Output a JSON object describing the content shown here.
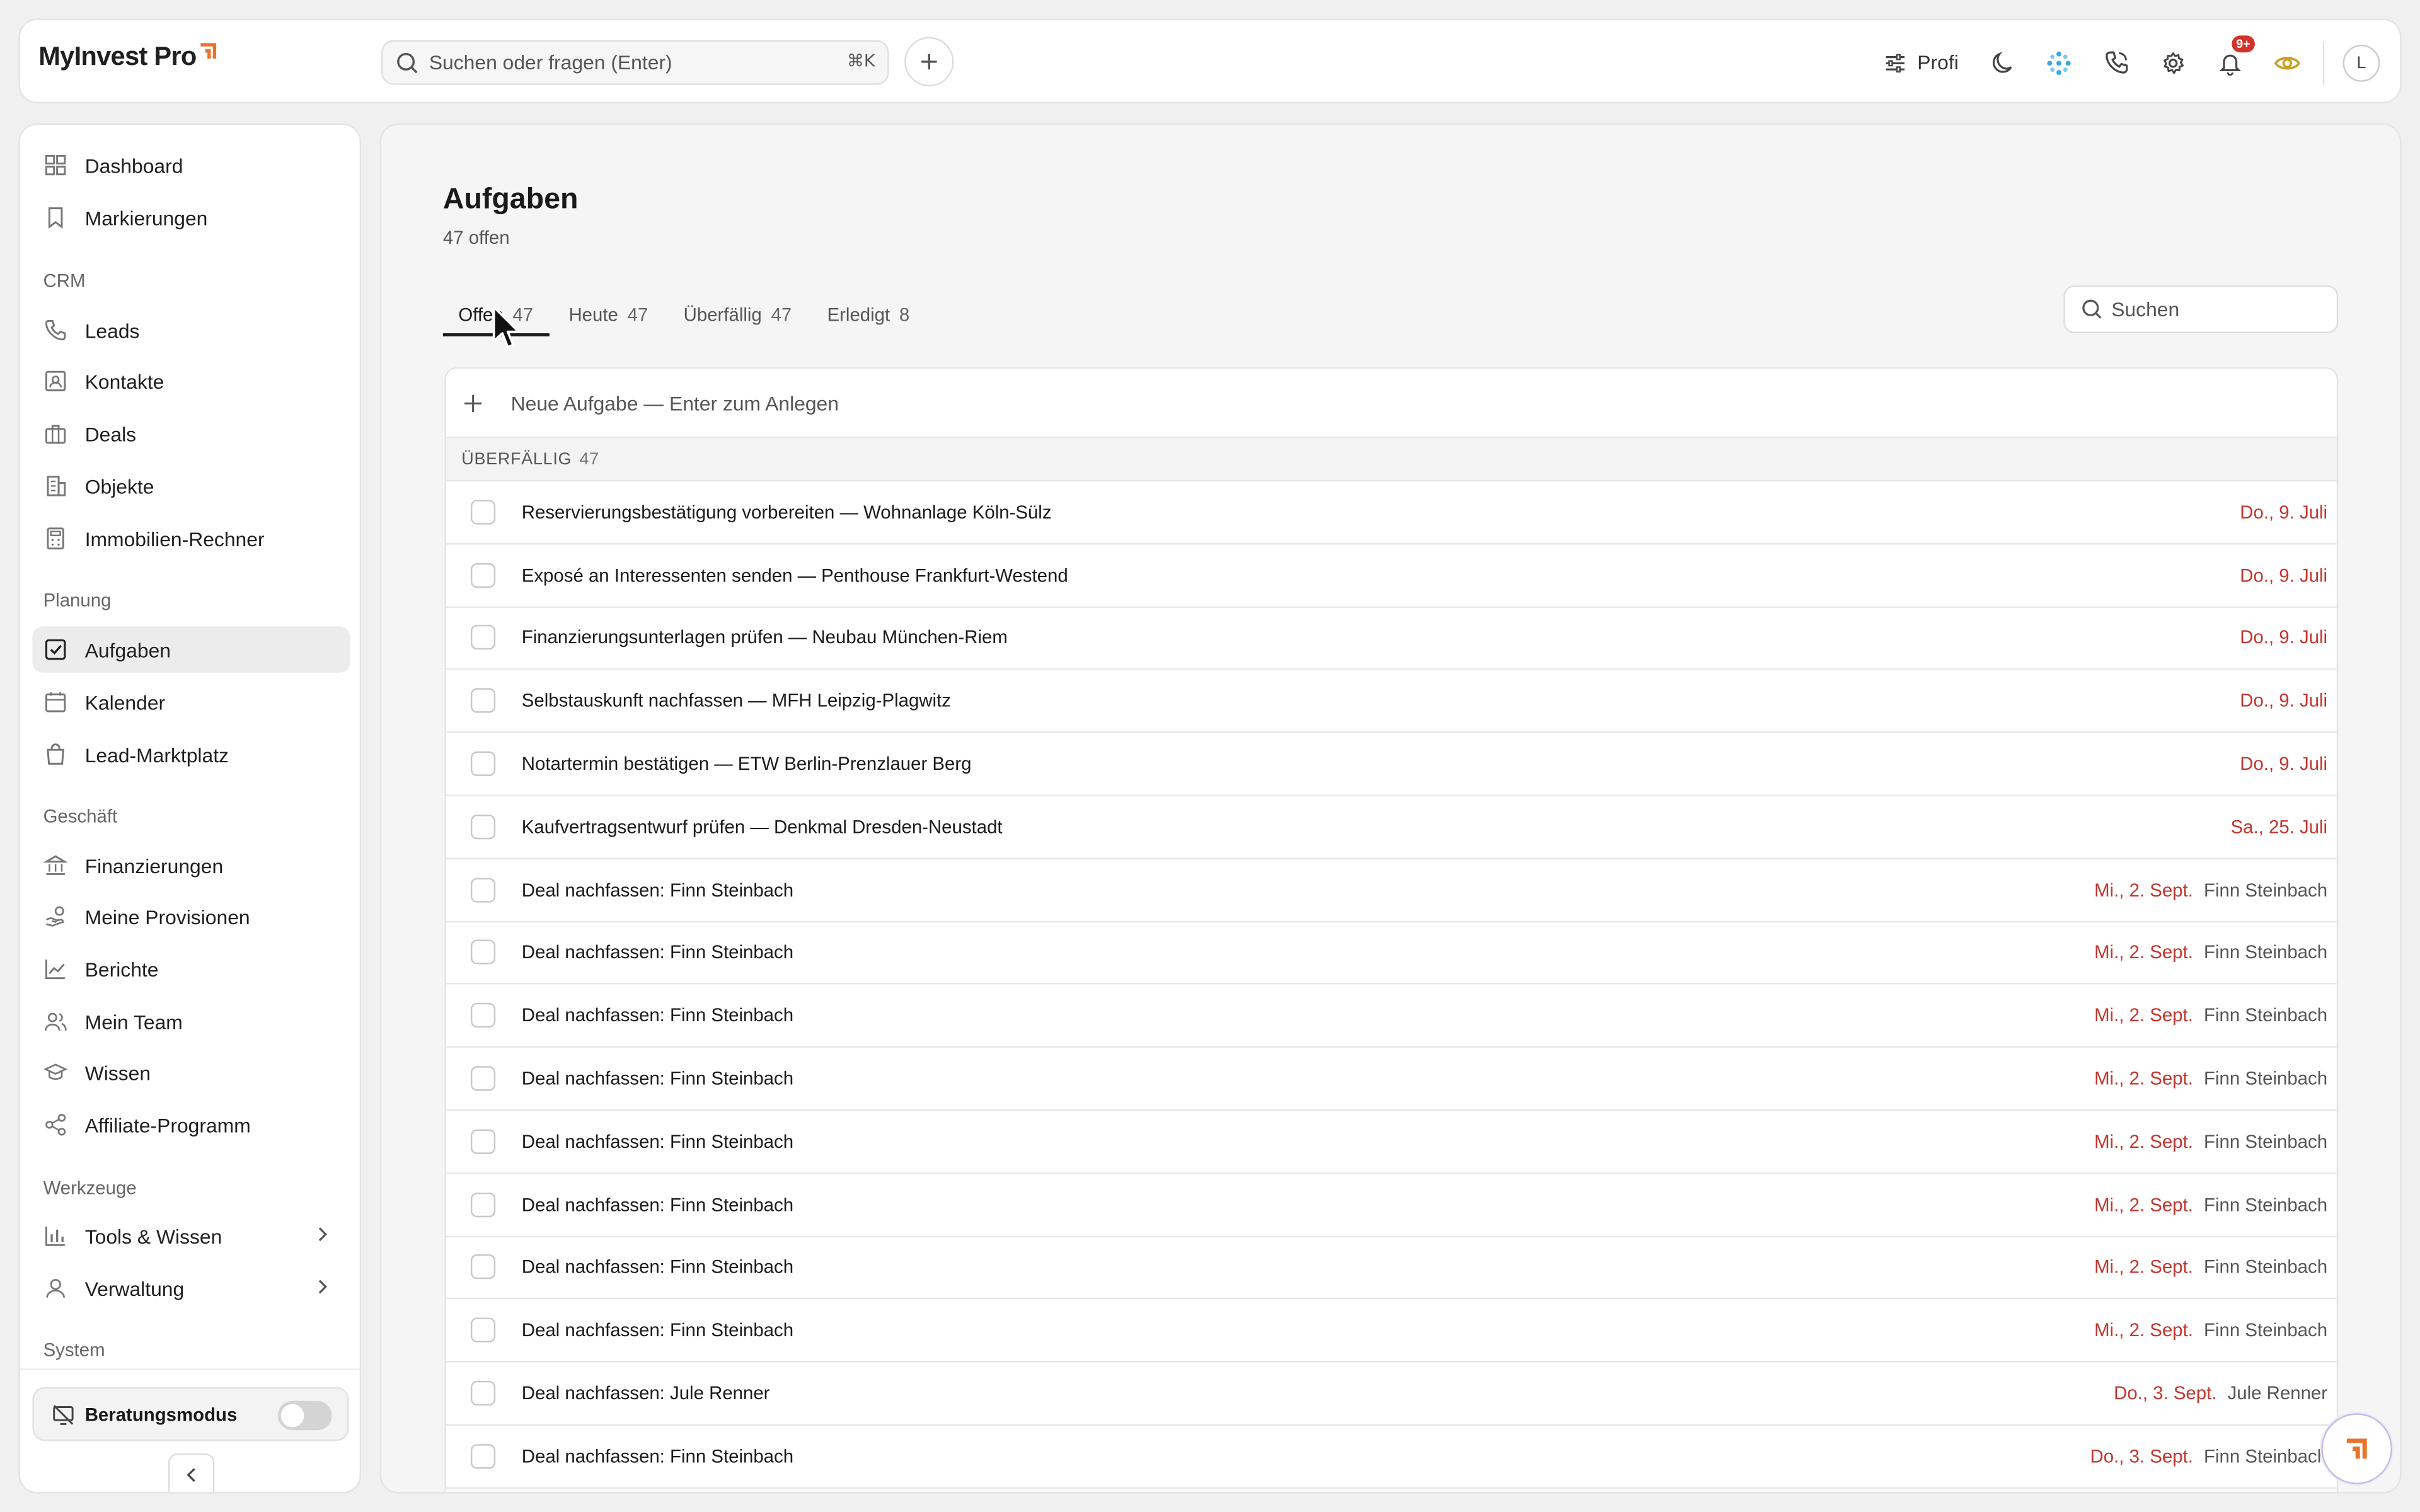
{
  "app": {
    "brand": "MyInvest Pro",
    "accent": "#e8732a"
  },
  "topbar": {
    "search_placeholder": "Suchen oder fragen (Enter)",
    "search_shortcut": "⌘K",
    "profile_mode": "Profi",
    "notifications_badge": "9+",
    "avatar_initial": "L"
  },
  "sidebar": {
    "top_items": [
      {
        "label": "Dashboard"
      },
      {
        "label": "Markierungen"
      }
    ],
    "crm": {
      "title": "CRM",
      "items": [
        {
          "label": "Leads"
        },
        {
          "label": "Kontakte"
        },
        {
          "label": "Deals"
        },
        {
          "label": "Objekte"
        },
        {
          "label": "Immobilien-Rechner"
        }
      ]
    },
    "planung": {
      "title": "Planung",
      "items": [
        {
          "label": "Aufgaben"
        },
        {
          "label": "Kalender"
        },
        {
          "label": "Lead-Marktplatz"
        }
      ]
    },
    "geschaeft": {
      "title": "Geschäft",
      "items": [
        {
          "label": "Finanzierungen"
        },
        {
          "label": "Meine Provisionen"
        },
        {
          "label": "Berichte"
        },
        {
          "label": "Mein Team"
        },
        {
          "label": "Wissen"
        },
        {
          "label": "Affiliate-Programm"
        }
      ]
    },
    "werkzeuge": {
      "title": "Werkzeuge",
      "items": [
        {
          "label": "Tools & Wissen"
        },
        {
          "label": "Verwaltung"
        }
      ]
    },
    "system": {
      "title": "System"
    },
    "beratungsmodus": {
      "label": "Beratungsmodus",
      "enabled": false
    },
    "active_item": "Aufgaben"
  },
  "main": {
    "title": "Aufgaben",
    "subtitle": "47 offen",
    "tabs": [
      {
        "label": "Offen",
        "count": "47"
      },
      {
        "label": "Heute",
        "count": "47"
      },
      {
        "label": "Überfällig",
        "count": "47"
      },
      {
        "label": "Erledigt",
        "count": "8"
      }
    ],
    "active_tab": "Offen",
    "search_placeholder": "Suchen",
    "new_task_placeholder": "Neue Aufgabe — Enter zum Anlegen",
    "group": {
      "label": "ÜBERFÄLLIG",
      "count": "47"
    },
    "tasks": [
      {
        "title": "Reservierungsbestätigung vorbereiten — Wohnanlage Köln-Sülz",
        "date": "Do., 9. Juli",
        "assignee": ""
      },
      {
        "title": "Exposé an Interessenten senden — Penthouse Frankfurt-Westend",
        "date": "Do., 9. Juli",
        "assignee": ""
      },
      {
        "title": "Finanzierungsunterlagen prüfen — Neubau München-Riem",
        "date": "Do., 9. Juli",
        "assignee": ""
      },
      {
        "title": "Selbstauskunft nachfassen — MFH Leipzig-Plagwitz",
        "date": "Do., 9. Juli",
        "assignee": ""
      },
      {
        "title": "Notartermin bestätigen — ETW Berlin-Prenzlauer Berg",
        "date": "Do., 9. Juli",
        "assignee": ""
      },
      {
        "title": "Kaufvertragsentwurf prüfen — Denkmal Dresden-Neustadt",
        "date": "Sa., 25. Juli",
        "assignee": ""
      },
      {
        "title": "Deal nachfassen: Finn Steinbach",
        "date": "Mi., 2. Sept.",
        "assignee": "Finn Steinbach"
      },
      {
        "title": "Deal nachfassen: Finn Steinbach",
        "date": "Mi., 2. Sept.",
        "assignee": "Finn Steinbach"
      },
      {
        "title": "Deal nachfassen: Finn Steinbach",
        "date": "Mi., 2. Sept.",
        "assignee": "Finn Steinbach"
      },
      {
        "title": "Deal nachfassen: Finn Steinbach",
        "date": "Mi., 2. Sept.",
        "assignee": "Finn Steinbach"
      },
      {
        "title": "Deal nachfassen: Finn Steinbach",
        "date": "Mi., 2. Sept.",
        "assignee": "Finn Steinbach"
      },
      {
        "title": "Deal nachfassen: Finn Steinbach",
        "date": "Mi., 2. Sept.",
        "assignee": "Finn Steinbach"
      },
      {
        "title": "Deal nachfassen: Finn Steinbach",
        "date": "Mi., 2. Sept.",
        "assignee": "Finn Steinbach"
      },
      {
        "title": "Deal nachfassen: Finn Steinbach",
        "date": "Mi., 2. Sept.",
        "assignee": "Finn Steinbach"
      },
      {
        "title": "Deal nachfassen: Jule Renner",
        "date": "Do., 3. Sept.",
        "assignee": "Jule Renner"
      },
      {
        "title": "Deal nachfassen: Finn Steinbach",
        "date": "Do., 3. Sept.",
        "assignee": "Finn Steinbach"
      }
    ]
  }
}
